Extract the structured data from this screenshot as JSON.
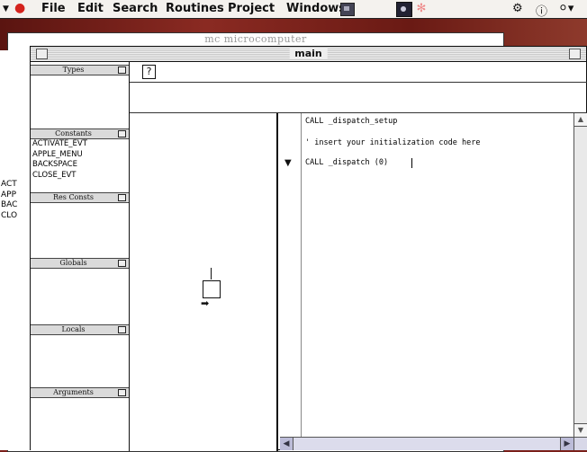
{
  "menubar": {
    "items": [
      "File",
      "Edit",
      "Search",
      "Routines",
      "Project",
      "Windows"
    ],
    "right_icons": [
      "app-icon",
      "help-icon",
      "balloon-icon"
    ]
  },
  "back_window": {
    "title": "mc microcomputer",
    "list": [
      "ACT",
      "APP",
      "BAC",
      "CLO"
    ]
  },
  "main_window": {
    "title": "main",
    "help_label": "?"
  },
  "palette": {
    "types": {
      "label": "Types",
      "items": []
    },
    "constants": {
      "label": "Constants",
      "items": [
        "ACTIVATE_EVT",
        "APPLE_MENU",
        "BACKSPACE",
        "CLOSE_EVT"
      ]
    },
    "res_consts": {
      "label": "Res Consts",
      "items": []
    },
    "globals": {
      "label": "Globals",
      "items": []
    },
    "locals": {
      "label": "Locals",
      "items": []
    },
    "arguments": {
      "label": "Arguments",
      "items": []
    }
  },
  "code": {
    "lines": [
      "CALL _dispatch_setup",
      "' insert your initialization code here",
      "CALL _dispatch (0)"
    ]
  },
  "colors": {
    "desktop": "#7a1f1a",
    "apple": "#d4231d",
    "scrollbar": "#dcdcec"
  }
}
